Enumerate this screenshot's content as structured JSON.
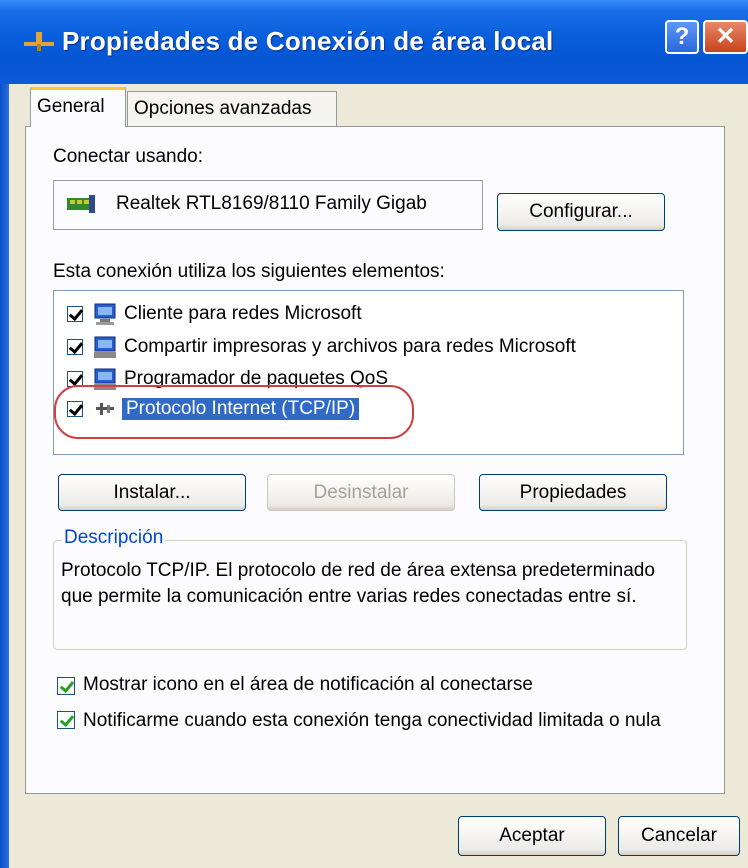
{
  "window": {
    "title": "Propiedades de Conexión de área local",
    "help_button": "?",
    "close_button": "✕"
  },
  "tabs": [
    {
      "label": "General",
      "active": true
    },
    {
      "label": "Opciones avanzadas",
      "active": false
    }
  ],
  "connect_using": {
    "label": "Conectar usando:",
    "adapter": "Realtek RTL8169/8110 Family Gigab",
    "configure_button": "Configurar..."
  },
  "components": {
    "label": "Esta conexión utiliza los siguientes elementos:",
    "items": [
      {
        "label": "Cliente para redes Microsoft",
        "checked": true,
        "icon": "network-client-icon"
      },
      {
        "label": "Compartir impresoras y archivos para redes Microsoft",
        "checked": true,
        "icon": "file-printer-sharing-icon"
      },
      {
        "label": "Programador de paquetes QoS",
        "checked": true,
        "icon": "qos-scheduler-icon"
      },
      {
        "label": "Protocolo Internet (TCP/IP)",
        "checked": true,
        "selected": true,
        "icon": "protocol-icon"
      }
    ]
  },
  "buttons": {
    "install": "Instalar...",
    "uninstall": "Desinstalar",
    "properties": "Propiedades"
  },
  "description": {
    "title": "Descripción",
    "text": "Protocolo TCP/IP. El protocolo de red de área extensa predeterminado que permite la comunicación entre varias redes conectadas entre sí."
  },
  "options": {
    "show_icon": "Mostrar icono en el área de notificación al conectarse",
    "notify": "Notificarme cuando esta conexión tenga conectividad limitada o nula"
  },
  "footer": {
    "ok": "Aceptar",
    "cancel": "Cancelar"
  },
  "colors": {
    "title_bar": "#0656d4",
    "selection": "#316ac5",
    "active_tab_accent": "#ffc83c",
    "highlight_oval": "#d04040"
  }
}
